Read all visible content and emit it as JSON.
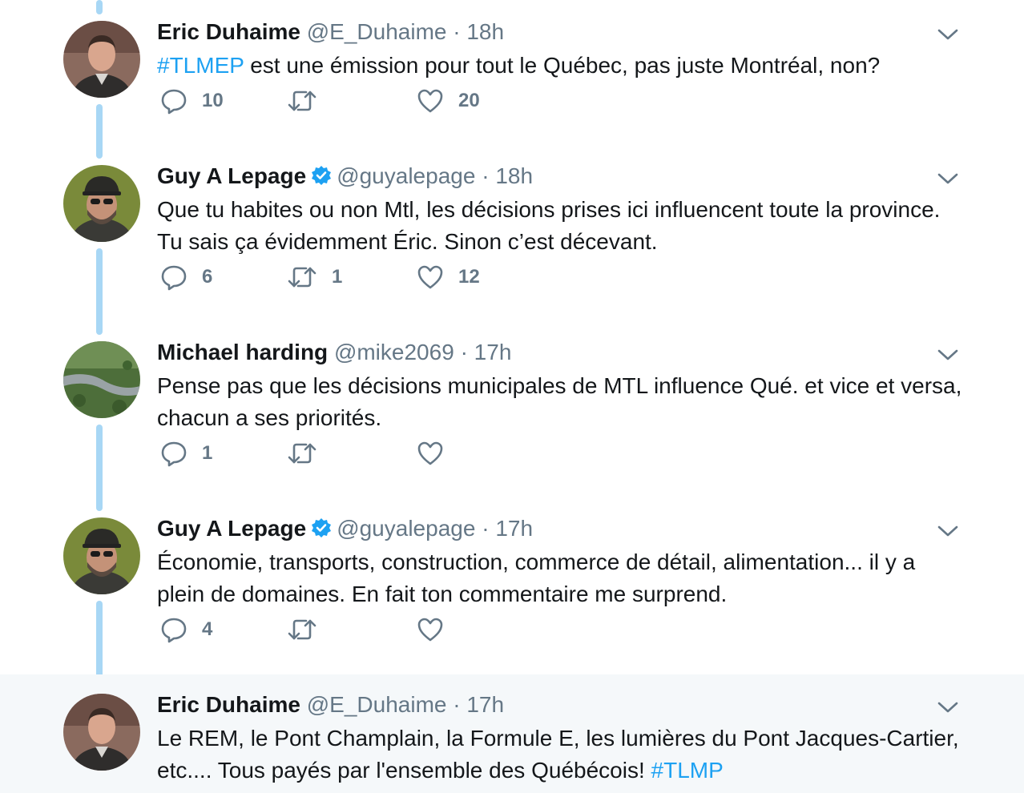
{
  "tweets": [
    {
      "name": "Eric Duhaime",
      "handle": "@E_Duhaime",
      "time": "18h",
      "verified": false,
      "text_segments": [
        {
          "text": "#TLMEP",
          "hashtag": true
        },
        {
          "text": " est une émission pour tout le Québec, pas juste Montréal, non?",
          "hashtag": false
        }
      ],
      "replies": "10",
      "retweets": "",
      "likes": "20"
    },
    {
      "name": "Guy A Lepage",
      "handle": "@guyalepage",
      "time": "18h",
      "verified": true,
      "text_segments": [
        {
          "text": "Que tu habites ou non Mtl, les décisions prises ici influencent toute la province. Tu sais ça évidemment Éric. Sinon c’est décevant.",
          "hashtag": false
        }
      ],
      "replies": "6",
      "retweets": "1",
      "likes": "12"
    },
    {
      "name": "Michael harding",
      "handle": "@mike2069",
      "time": "17h",
      "verified": false,
      "text_segments": [
        {
          "text": "Pense pas que les décisions municipales de MTL influence Qué. et vice et versa, chacun a ses priorités.",
          "hashtag": false
        }
      ],
      "replies": "1",
      "retweets": "",
      "likes": ""
    },
    {
      "name": "Guy A Lepage",
      "handle": "@guyalepage",
      "time": "17h",
      "verified": true,
      "text_segments": [
        {
          "text": "Économie, transports, construction, commerce de détail, alimentation... il y a plein de domaines. En fait ton commentaire me surprend.",
          "hashtag": false
        }
      ],
      "replies": "4",
      "retweets": "",
      "likes": ""
    },
    {
      "name": "Eric Duhaime",
      "handle": "@E_Duhaime",
      "time": "17h",
      "verified": false,
      "text_segments": [
        {
          "text": "Le REM, le Pont Champlain, la Formule E, les lumières du Pont Jacques-Cartier, etc.... Tous payés par l'ensemble des Québécois! ",
          "hashtag": false
        },
        {
          "text": "#TLMP",
          "hashtag": true
        }
      ],
      "replies": "",
      "retweets": "",
      "likes": ""
    }
  ],
  "colors": {
    "thread_line": "#a8d7f5",
    "hashtag": "#1da1f2",
    "muted": "#657786",
    "highlight_bg": "#f5f8fa"
  },
  "icons": {
    "reply": "speech-bubble-icon",
    "retweet": "retweet-arrows-icon",
    "like": "heart-icon",
    "caret": "chevron-down-icon",
    "verified": "verified-badge-icon"
  }
}
